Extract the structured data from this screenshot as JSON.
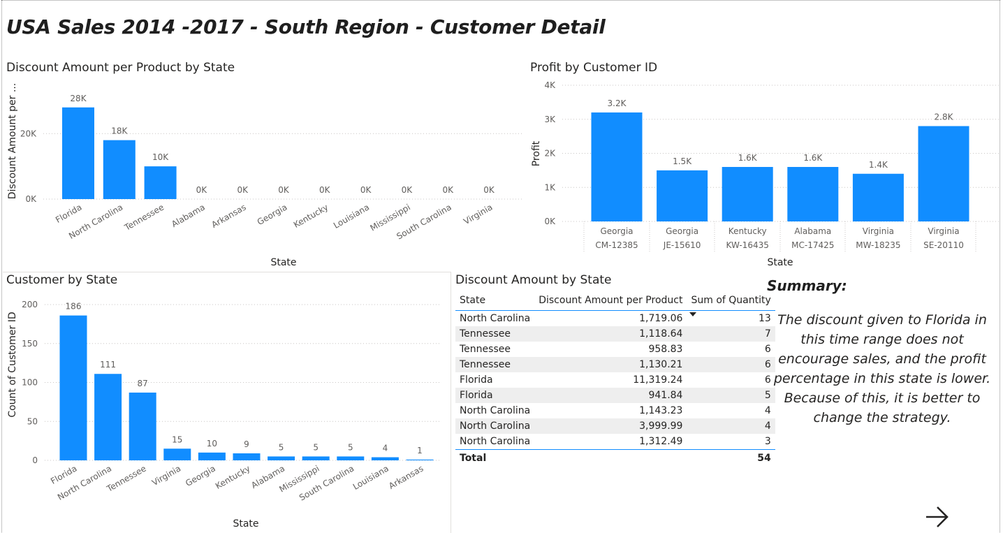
{
  "page": {
    "title": "USA Sales 2014 -2017 - South Region  - Customer  Detail"
  },
  "discount_chart": {
    "title": "Discount Amount per Product by State",
    "chart_data": {
      "type": "bar",
      "title": "Discount Amount per Product by State",
      "xlabel": "State",
      "ylabel": "Discount Amount per ...",
      "categories": [
        "Florida",
        "North Carolina",
        "Tennessee",
        "Alabama",
        "Arkansas",
        "Georgia",
        "Kentucky",
        "Louisiana",
        "Mississippi",
        "South Carolina",
        "Virginia"
      ],
      "values": [
        28000,
        18000,
        10000,
        0,
        0,
        0,
        0,
        0,
        0,
        0,
        0
      ],
      "data_labels": [
        "28K",
        "18K",
        "10K",
        "0K",
        "0K",
        "0K",
        "0K",
        "0K",
        "0K",
        "0K",
        "0K"
      ],
      "yticks": [
        "0K",
        "20K"
      ],
      "ylim": [
        0,
        32000
      ],
      "grid": true
    }
  },
  "profit_chart": {
    "title": "Profit by Customer ID",
    "chart_data": {
      "type": "bar",
      "title": "Profit by Customer ID",
      "xlabel": "State",
      "ylabel": "Profit",
      "categories": [
        [
          "Georgia",
          "CM-12385"
        ],
        [
          "Georgia",
          "JE-15610"
        ],
        [
          "Kentucky",
          "KW-16435"
        ],
        [
          "Alabama",
          "MC-17425"
        ],
        [
          "Virginia",
          "MW-18235"
        ],
        [
          "Virginia",
          "SE-20110"
        ]
      ],
      "values": [
        3200,
        1500,
        1600,
        1600,
        1400,
        2800
      ],
      "data_labels": [
        "3.2K",
        "1.5K",
        "1.6K",
        "1.6K",
        "1.4K",
        "2.8K"
      ],
      "yticks": [
        "0K",
        "1K",
        "2K",
        "3K",
        "4K"
      ],
      "ylim": [
        0,
        4000
      ],
      "grid": true
    }
  },
  "customer_chart": {
    "title": "Customer by State",
    "chart_data": {
      "type": "bar",
      "title": "Customer by State",
      "xlabel": "State",
      "ylabel": "Count of Customer ID",
      "categories": [
        "Florida",
        "North Carolina",
        "Tennessee",
        "Virginia",
        "Georgia",
        "Kentucky",
        "Alabama",
        "Mississippi",
        "South Carolina",
        "Louisiana",
        "Arkansas"
      ],
      "values": [
        186,
        111,
        87,
        15,
        10,
        9,
        5,
        5,
        5,
        4,
        1
      ],
      "yticks": [
        "0",
        "50",
        "100",
        "150",
        "200"
      ],
      "ylim": [
        0,
        200
      ],
      "grid": true
    }
  },
  "discount_table": {
    "title": "Discount Amount by State",
    "columns": [
      "State",
      "Discount Amount per Product",
      "Sum of Quantity"
    ],
    "sorted_column": "Sum of Quantity",
    "rows": [
      [
        "North Carolina",
        "1,719.06",
        "13"
      ],
      [
        "Tennessee",
        "1,118.64",
        "7"
      ],
      [
        "Tennessee",
        "958.83",
        "6"
      ],
      [
        "Tennessee",
        "1,130.21",
        "6"
      ],
      [
        "Florida",
        "11,319.24",
        "6"
      ],
      [
        "Florida",
        "941.84",
        "5"
      ],
      [
        "North Carolina",
        "1,143.23",
        "4"
      ],
      [
        "North Carolina",
        "3,999.99",
        "4"
      ],
      [
        "North Carolina",
        "1,312.49",
        "3"
      ]
    ],
    "total": {
      "label": "Total",
      "value": "",
      "quantity": "54"
    }
  },
  "summary": {
    "heading": "Summary:",
    "text": "The discount given to Florida in this time range does not encourage sales, and the profit percentage in this state is lower. Because of this, it is better to change the strategy."
  },
  "navigation": {
    "next_icon": "arrow-right-icon"
  },
  "colors": {
    "bar": "#118dff",
    "accent_line": "#118dff"
  }
}
